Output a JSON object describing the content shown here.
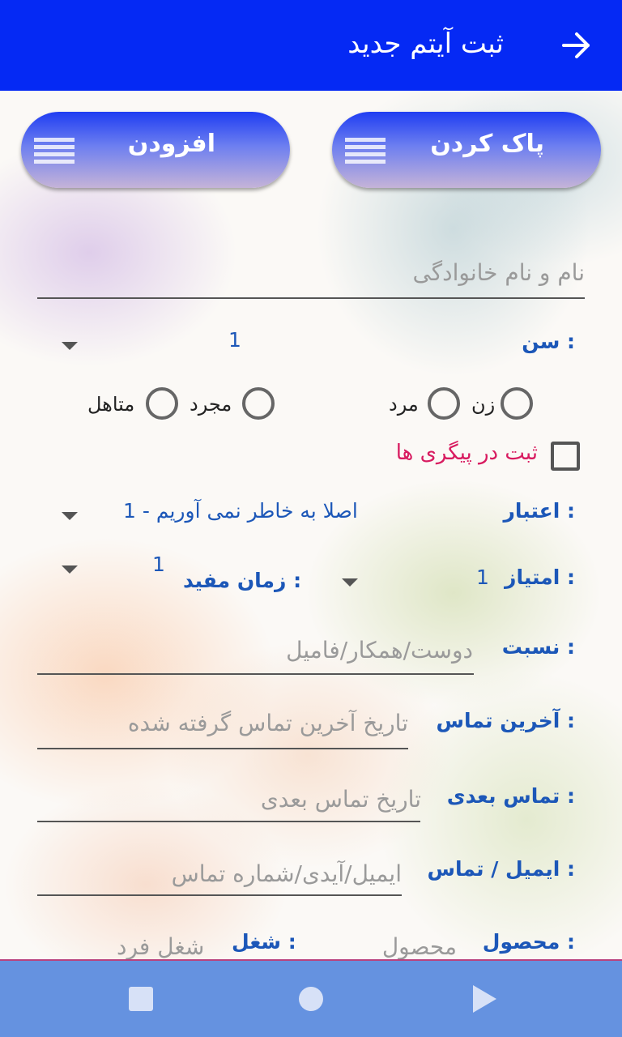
{
  "appbar": {
    "title": "ثبت آیتم جدید",
    "back_icon": "arrow-right-icon",
    "color": "#0529f4"
  },
  "actions": {
    "clear_label": "پاک کردن",
    "add_label": "افزودن",
    "menu_icon": "menu-lines-icon"
  },
  "form": {
    "full_name_placeholder": "نام و نام خانوادگی",
    "age_label": "سن :",
    "age_value": "1",
    "gender": {
      "female": "زن",
      "male": "مرد"
    },
    "marital": {
      "single": "مجرد",
      "married": "متاهل"
    },
    "followup_label": "ثبت در پیگری ها",
    "credit_label": "اعتبار :",
    "credit_value": "1 - اصلا به خاطر نمی آوریم",
    "score_label": "امتیاز :",
    "score_value": "1",
    "useful_time_label": "زمان مفید :",
    "useful_time_value": "1",
    "relation_label": "نسبت :",
    "relation_placeholder": "دوست/همکار/فامیل",
    "last_contact_label": "آخرین تماس :",
    "last_contact_placeholder": "تاریخ آخرین تماس گرفته شده",
    "next_contact_label": "تماس بعدی :",
    "next_contact_placeholder": "تاریخ تماس بعدی",
    "email_label": "ایمیل / تماس :",
    "email_placeholder": "ایمیل/آیدی/شماره تماس",
    "product_label": "محصول :",
    "product_placeholder": "محصول",
    "job_label": "شغل :",
    "job_placeholder": "شغل فرد"
  },
  "navbar": {
    "back_icon": "triangle-back-icon",
    "home_icon": "circle-home-icon",
    "recents_icon": "square-recents-icon"
  }
}
